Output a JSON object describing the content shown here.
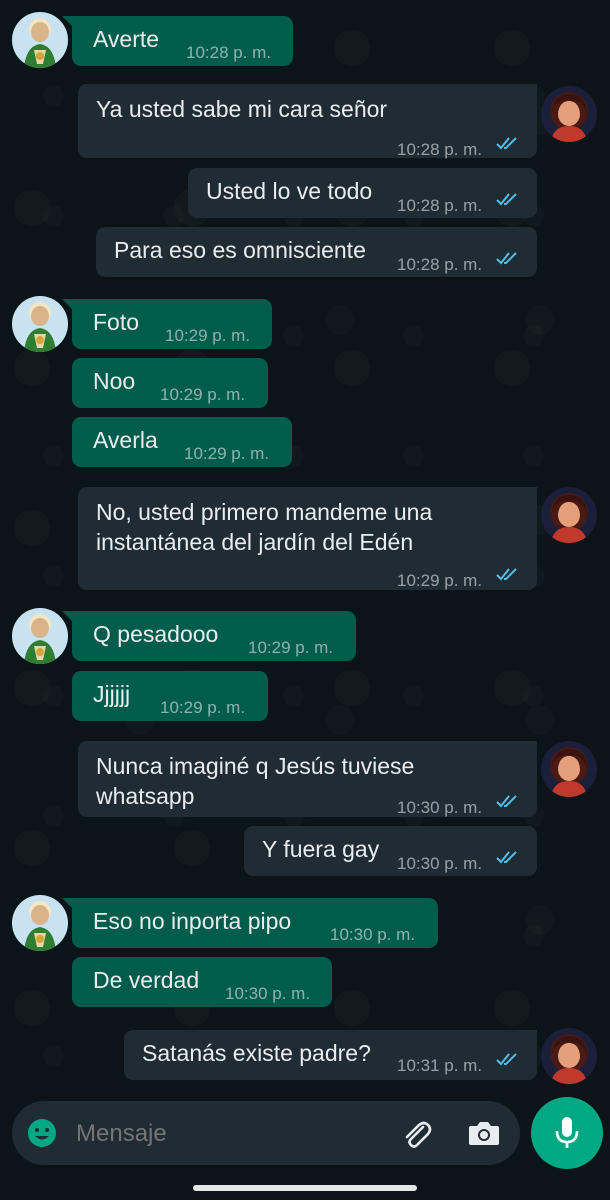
{
  "colors": {
    "incoming_bubble": "#005c4b",
    "outgoing_bubble": "#202c33",
    "read_ticks": "#53bdeb",
    "mic_button": "#00a884",
    "background": "#0b1418"
  },
  "messages": [
    {
      "text": "Averte",
      "time": "10:28 p. m."
    },
    {
      "text": "Ya usted sabe mi cara señor",
      "time": "10:28 p. m."
    },
    {
      "text": "Usted lo ve todo",
      "time": "10:28 p. m."
    },
    {
      "text": "Para eso es omnisciente",
      "time": "10:28 p. m."
    },
    {
      "text": "Foto",
      "time": "10:29 p. m."
    },
    {
      "text": "Noo",
      "time": "10:29 p. m."
    },
    {
      "text": "Averla",
      "time": "10:29 p. m."
    },
    {
      "text_line1": "No, usted primero mandeme una",
      "text_line2": "instantánea del jardín del Edén",
      "time": "10:29 p. m."
    },
    {
      "text": "Q pesadooo",
      "time": "10:29 p. m."
    },
    {
      "text": "Jjjjjj",
      "time": "10:29 p. m."
    },
    {
      "text_line1": "Nunca imaginé q Jesús tuviese",
      "text_line2": "whatsapp",
      "time": "10:30 p. m."
    },
    {
      "text": "Y fuera gay",
      "time": "10:30 p. m."
    },
    {
      "text": "Eso no inporta pipo",
      "time": "10:30 p. m."
    },
    {
      "text": "De verdad",
      "time": "10:30 p. m."
    },
    {
      "text": "Satanás existe padre?",
      "time": "10:31 p. m."
    }
  ],
  "composer": {
    "placeholder": "Mensaje",
    "emoji_icon": "emoji-icon",
    "attach_icon": "paperclip-icon",
    "camera_icon": "camera-icon",
    "mic_icon": "microphone-icon"
  }
}
